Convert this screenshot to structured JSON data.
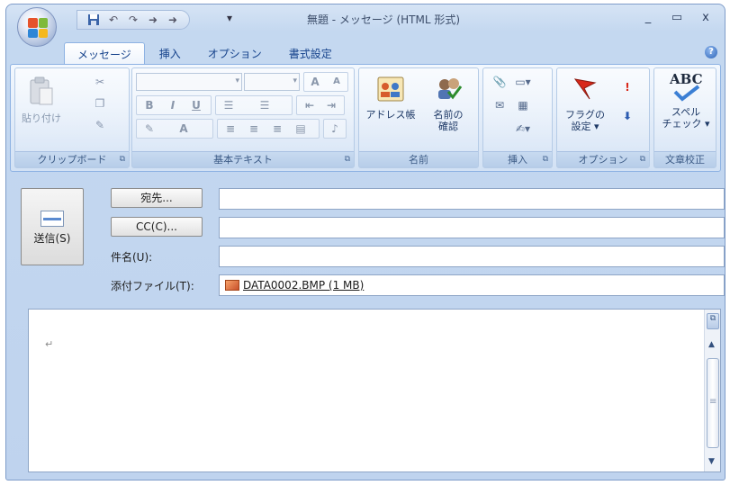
{
  "window": {
    "title": "無題 - メッセージ (HTML 形式)",
    "controls": {
      "minimize": "_",
      "maximize": "▭",
      "close": "x"
    }
  },
  "qat": {
    "customize": "▾"
  },
  "tabs": [
    {
      "label": "メッセージ",
      "active": true
    },
    {
      "label": "挿入",
      "active": false
    },
    {
      "label": "オプション",
      "active": false
    },
    {
      "label": "書式設定",
      "active": false
    }
  ],
  "ribbon": {
    "clipboard": {
      "label": "クリップボード",
      "paste": "貼り付け"
    },
    "basic_text": {
      "label": "基本テキスト",
      "grow_font": "A",
      "shrink_font": "A",
      "bold": "B",
      "italic": "I",
      "underline": "U",
      "font_color": "A"
    },
    "names": {
      "label": "名前",
      "address_book": "アドレス帳",
      "check_names_line1": "名前の",
      "check_names_line2": "確認"
    },
    "insert": {
      "label": "挿入"
    },
    "options": {
      "label": "オプション",
      "follow_up_line1": "フラグの",
      "follow_up_line2": "設定 ▾"
    },
    "proofing": {
      "label": "文章校正",
      "abc": "ABC",
      "spelling_line1": "スペル",
      "spelling_line2": "チェック ▾"
    }
  },
  "compose": {
    "send": "送信(S)",
    "to_button": "宛先...",
    "cc_button": "CC(C)...",
    "subject_label": "件名(U):",
    "attachment_label": "添付ファイル(T):",
    "attachment_file": "DATA0002.BMP (1 MB)",
    "to_value": "",
    "cc_value": "",
    "subject_value": ""
  },
  "body": {
    "paragraph_mark": "↵"
  },
  "colors": {
    "ribbon_blue": "#15428b",
    "frame": "#bfd3ee",
    "flag_red": "#d8281a"
  }
}
